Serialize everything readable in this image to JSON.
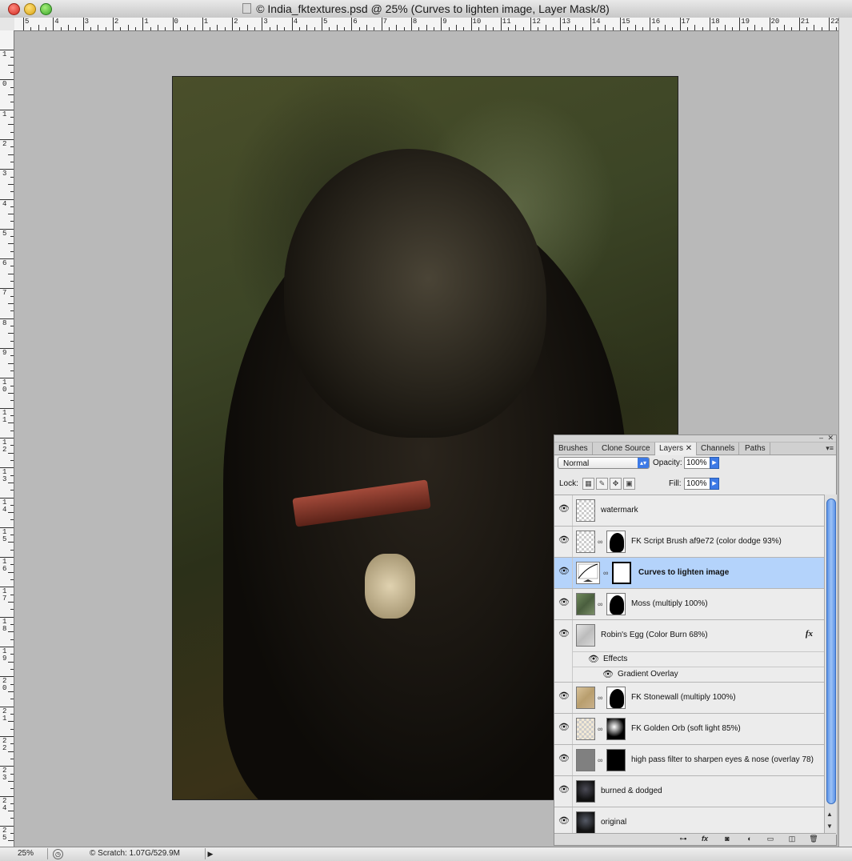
{
  "window": {
    "title": "© India_fktextures.psd @ 25% (Curves  to lighten image, Layer Mask/8)"
  },
  "ruler_h_labels": [
    "5",
    "4",
    "3",
    "2",
    "1",
    "0",
    "1",
    "2",
    "3",
    "4",
    "5",
    "6",
    "7",
    "8",
    "9",
    "10",
    "11",
    "12",
    "13",
    "14",
    "15",
    "16",
    "17",
    "18",
    "19",
    "20",
    "21",
    "22"
  ],
  "ruler_v_labels": [
    "1",
    "0",
    "1",
    "2",
    "3",
    "4",
    "5",
    "6",
    "7",
    "8",
    "9",
    "1 0",
    "1 1",
    "1 2",
    "1 3",
    "1 4",
    "1 5",
    "1 6",
    "1 7",
    "1 8",
    "1 9",
    "2 0",
    "2 1",
    "2 2",
    "2 3",
    "2 4",
    "2 5"
  ],
  "status": {
    "zoom": "25%",
    "scratch": "© Scratch: 1.07G/529.9M",
    "arrow": "▶"
  },
  "layers_panel": {
    "tabs": [
      "Brushes",
      "Clone Source",
      "Layers",
      "Channels",
      "Paths"
    ],
    "active_tab": "Layers",
    "tab_close": "✕",
    "menu_icon": "▾≡",
    "minimize": "‒",
    "close": "✕",
    "blend_mode": "Normal",
    "blend_arrow": "▴▾",
    "opacity_label": "Opacity:",
    "opacity_value": "100%",
    "lock_label": "Lock:",
    "fill_label": "Fill:",
    "fill_value": "100%",
    "layers": [
      {
        "name": "watermark",
        "thumb": "checker",
        "mask": ""
      },
      {
        "name": "FK Script Brush af9e72 (color dodge 93%)",
        "thumb": "checker",
        "mask": "dog"
      },
      {
        "name": "Curves  to lighten image",
        "thumb": "curves",
        "mask": "white",
        "selected": true
      },
      {
        "name": "Moss (multiply 100%)",
        "thumb": "moss",
        "mask": "dog"
      },
      {
        "name": "Robin's Egg (Color Burn 68%)",
        "thumb": "gray",
        "mask": "",
        "fx": "fx"
      },
      {
        "name": "FK Stonewall (multiply 100%)",
        "thumb": "stone",
        "mask": "dog"
      },
      {
        "name": "FK Golden Orb (soft light 85%)",
        "thumb": "checker",
        "mask": "orb"
      },
      {
        "name": "high pass filter to sharpen eyes & nose (overlay 78)",
        "thumb": "midgray",
        "mask": "black"
      },
      {
        "name": "burned & dodged",
        "thumb": "photo",
        "mask": ""
      },
      {
        "name": "original",
        "thumb": "photo",
        "mask": ""
      }
    ],
    "effects_label": "Effects",
    "gradient_overlay_label": "Gradient Overlay",
    "bottom_icons": [
      "link-icon",
      "fx-icon",
      "mask-icon",
      "adjustment-icon",
      "group-icon",
      "new-layer-icon",
      "trash-icon"
    ],
    "bottom_glyphs": [
      "⊶",
      "fx",
      "◙",
      "◐",
      "▭",
      "◫",
      "🗑"
    ]
  },
  "colors": {
    "selection": "#b4d3fb",
    "aqua_blue": "#3d7ae6"
  }
}
